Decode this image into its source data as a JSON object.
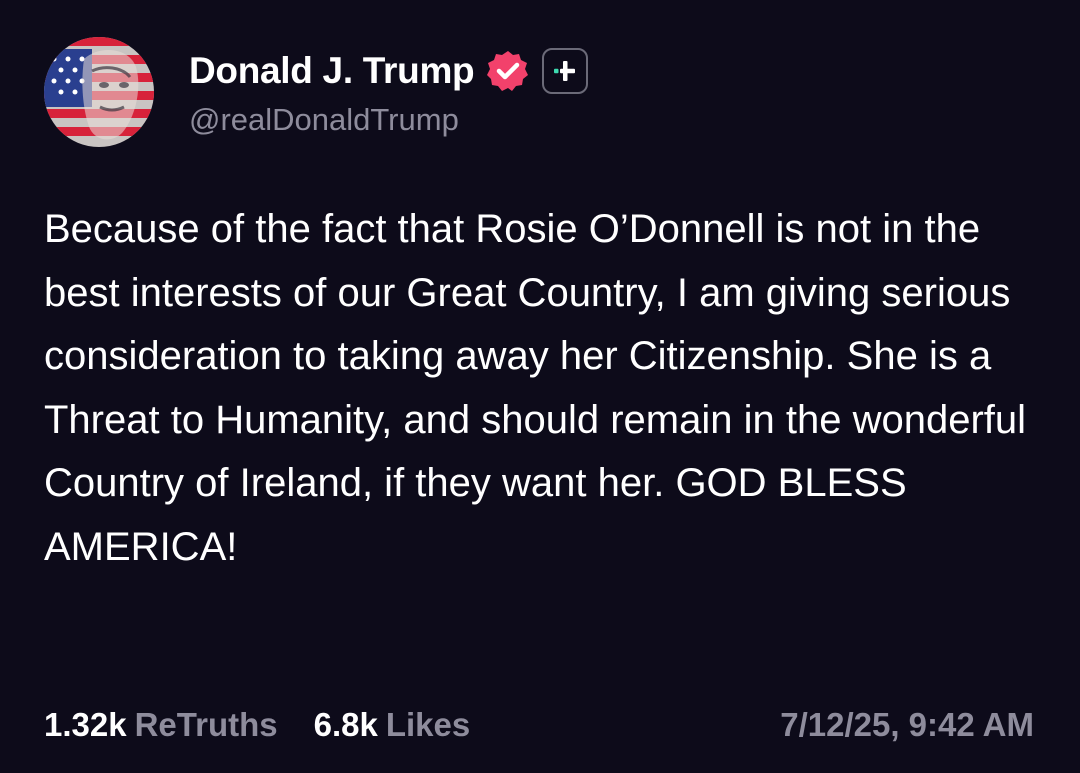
{
  "author": {
    "display_name": "Donald J. Trump",
    "handle": "@realDonaldTrump",
    "verified": true
  },
  "colors": {
    "background": "#0d0b1a",
    "verified_badge": "#f2416b",
    "follow_plus": "#3ddbb0",
    "muted_text": "#8e8c9c"
  },
  "icons": {
    "verified": "verified-badge-icon",
    "follow": "plus-icon"
  },
  "post": {
    "text": "Because of the fact that Rosie O’Donnell is not in the best interests of our Great Country, I am giving serious consideration to taking away her Citizenship. She is a Threat to Humanity, and should remain in the wonderful Country of Ireland, if they want her. GOD BLESS AMERICA!"
  },
  "stats": {
    "retruths_count": "1.32k",
    "retruths_label": "ReTruths",
    "likes_count": "6.8k",
    "likes_label": "Likes"
  },
  "timestamp": "7/12/25, 9:42 AM"
}
